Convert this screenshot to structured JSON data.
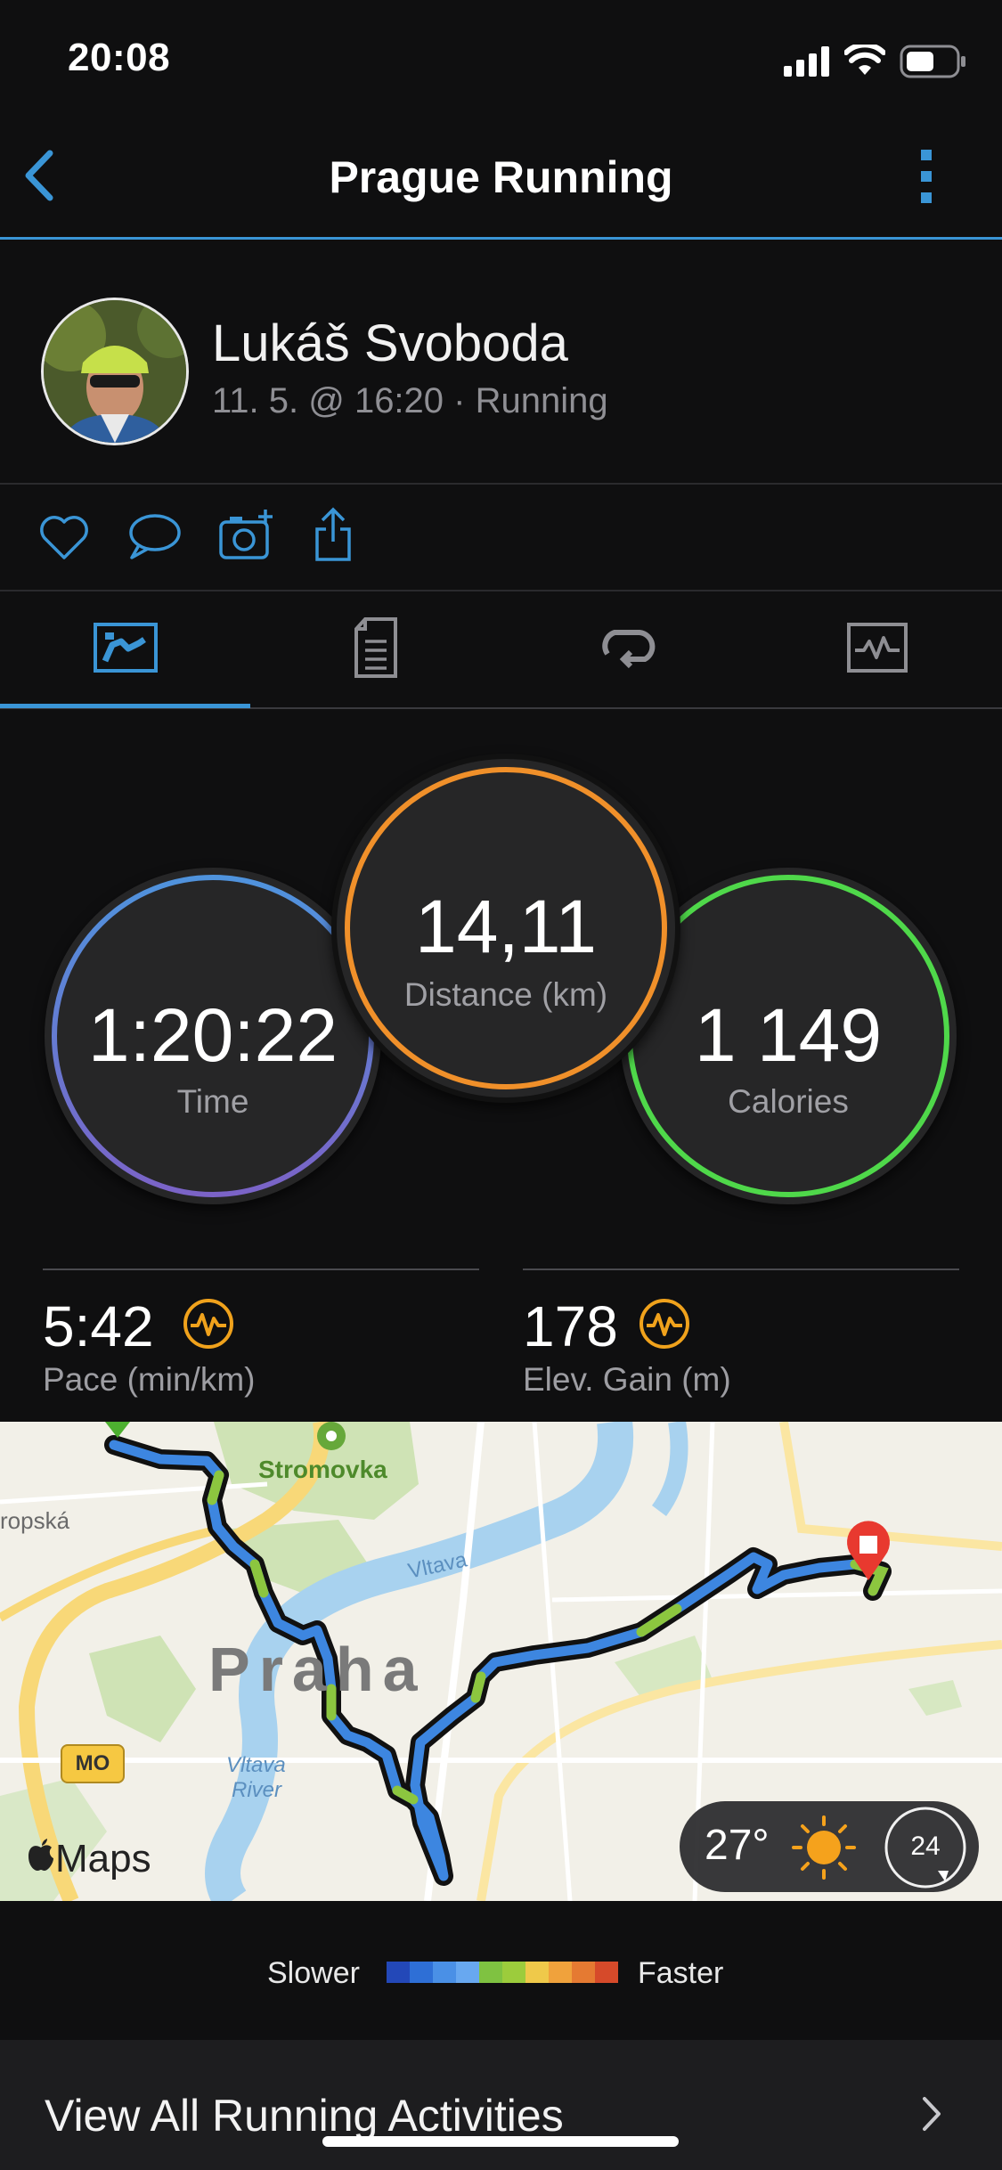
{
  "status_bar": {
    "time": "20:08"
  },
  "nav": {
    "title": "Prague Running"
  },
  "profile": {
    "name": "Lukáš Svoboda",
    "meta": "11. 5. @ 16:20 · Running"
  },
  "actions": [
    "like-icon",
    "comment-icon",
    "add-photo-icon",
    "share-icon"
  ],
  "tabs": [
    {
      "icon": "summary-icon",
      "active": true
    },
    {
      "icon": "details-icon",
      "active": false
    },
    {
      "icon": "laps-icon",
      "active": false
    },
    {
      "icon": "chart-icon",
      "active": false
    }
  ],
  "rings": {
    "time": {
      "value": "1:20:22",
      "label": "Time"
    },
    "distance": {
      "value": "14,11",
      "label": "Distance (km)"
    },
    "calories": {
      "value": "1 149",
      "label": "Calories"
    }
  },
  "stats": {
    "pace": {
      "value": "5:42",
      "label": "Pace (min/km)"
    },
    "elev": {
      "value": "178",
      "label": "Elev. Gain (m)"
    }
  },
  "map": {
    "labels": {
      "park": "Stromovka",
      "river": "Vltava",
      "river2_line1": "Vltava",
      "river2_line2": "River",
      "city": "Praha",
      "street": "ropská",
      "road_badge": "MO",
      "attribution": "Maps"
    }
  },
  "weather": {
    "temp": "27°",
    "wind": "24"
  },
  "legend": {
    "slower": "Slower",
    "faster": "Faster",
    "colors": [
      "#2348b8",
      "#2e6fd6",
      "#4a90e6",
      "#68a8f0",
      "#7fc241",
      "#9ccc3c",
      "#efc94a",
      "#f0a23c",
      "#e57a32",
      "#d64a2a"
    ]
  },
  "footer": {
    "label": "View All Running Activities"
  },
  "colors": {
    "accent": "#3a95d6",
    "time_ring": "#5b8fdc",
    "distance_ring": "#f0902a",
    "calories_ring": "#4fd84a",
    "metric_icon": "#f0a21c"
  }
}
